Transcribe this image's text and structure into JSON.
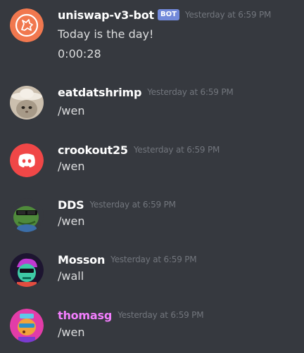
{
  "messages": [
    {
      "username": "uniswap-v3-bot",
      "bot_tag": "BOT",
      "timestamp": "Yesterday at 6:59 PM",
      "lines": [
        "Today is the day!",
        "0:00:28"
      ],
      "avatar": "unicorn-avatar",
      "avatar_color": "#f1784f"
    },
    {
      "username": "eatdatshrimp",
      "timestamp": "Yesterday at 6:59 PM",
      "lines": [
        "/wen"
      ],
      "avatar": "cat-cowboy-hat-avatar",
      "avatar_color": "#cbbfae"
    },
    {
      "username": "crookout25",
      "timestamp": "Yesterday at 6:59 PM",
      "lines": [
        "/wen"
      ],
      "avatar": "discord-logo-avatar",
      "avatar_color": "#f04747"
    },
    {
      "username": "DDS",
      "timestamp": "Yesterday at 6:59 PM",
      "lines": [
        "/wen"
      ],
      "avatar": "pepe-frog-avatar",
      "avatar_color": "#4f8a3b"
    },
    {
      "username": "Mosson",
      "timestamp": "Yesterday at 6:59 PM",
      "lines": [
        "/wall"
      ],
      "avatar": "punk-character-avatar",
      "avatar_color": "#1d1530"
    },
    {
      "username": "thomasg",
      "timestamp": "Yesterday at 6:59 PM",
      "lines": [
        "/wen"
      ],
      "avatar": "astronaut-character-avatar",
      "avatar_color": "#e23ca8",
      "name_color": "#f47fff"
    }
  ]
}
